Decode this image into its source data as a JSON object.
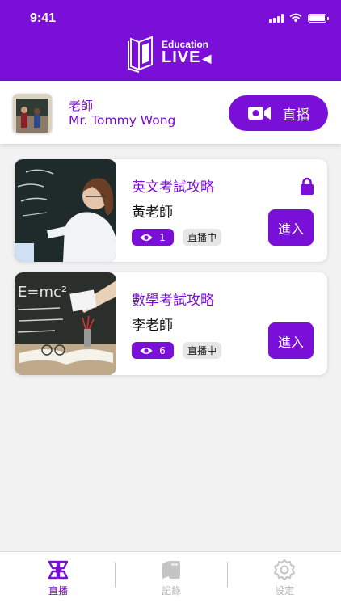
{
  "status_bar": {
    "time": "9:41"
  },
  "header": {
    "logo_top": "Education",
    "logo_bottom": "LIVE"
  },
  "profile": {
    "role": "老師",
    "name": "Mr. Tommy Wong",
    "live_button": "直播"
  },
  "cards": [
    {
      "title": "英文考試攻略",
      "teacher": "黃老師",
      "viewers": "1",
      "status": "直播中",
      "enter": "進入",
      "locked": true,
      "thumb": "classroom-blackboard-photo"
    },
    {
      "title": "數學考試攻略",
      "teacher": "李老師",
      "viewers": "6",
      "status": "直播中",
      "enter": "進入",
      "locked": false,
      "thumb": "math-chalkboard-photo"
    }
  ],
  "tabs": [
    {
      "label": "直播",
      "icon": "live-tab-icon",
      "active": true
    },
    {
      "label": "記錄",
      "icon": "record-tab-icon",
      "active": false
    },
    {
      "label": "設定",
      "icon": "settings-tab-icon",
      "active": false
    }
  ],
  "colors": {
    "accent": "#7a0fd8",
    "inactive": "#b8b8b8",
    "badge_gray": "#e6e6e6"
  }
}
